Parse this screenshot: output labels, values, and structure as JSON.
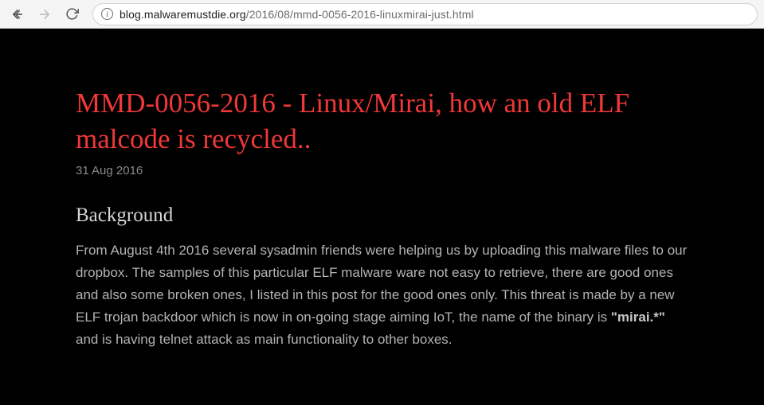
{
  "browser": {
    "url_domain": "blog.malwaremustdie.org",
    "url_path": "/2016/08/mmd-0056-2016-linuxmirai-just.html"
  },
  "post": {
    "title": "MMD-0056-2016 - Linux/Mirai, how an old ELF malcode is recycled..",
    "date": "31 Aug 2016",
    "section_heading": "Background",
    "body_before": "From August 4th 2016 several sysadmin friends were helping us by uploading this malware files to our dropbox. The samples of this particular ELF malware ware not easy to retrieve, there are good ones and also some broken ones, I listed in this post for the good ones only. This threat is made by a new ELF trojan backdoor which is now in on-going stage aiming IoT, the name of the binary is ",
    "body_bold": "\"mirai.*\"",
    "body_after": " and is having telnet attack as main functionality to other boxes."
  }
}
